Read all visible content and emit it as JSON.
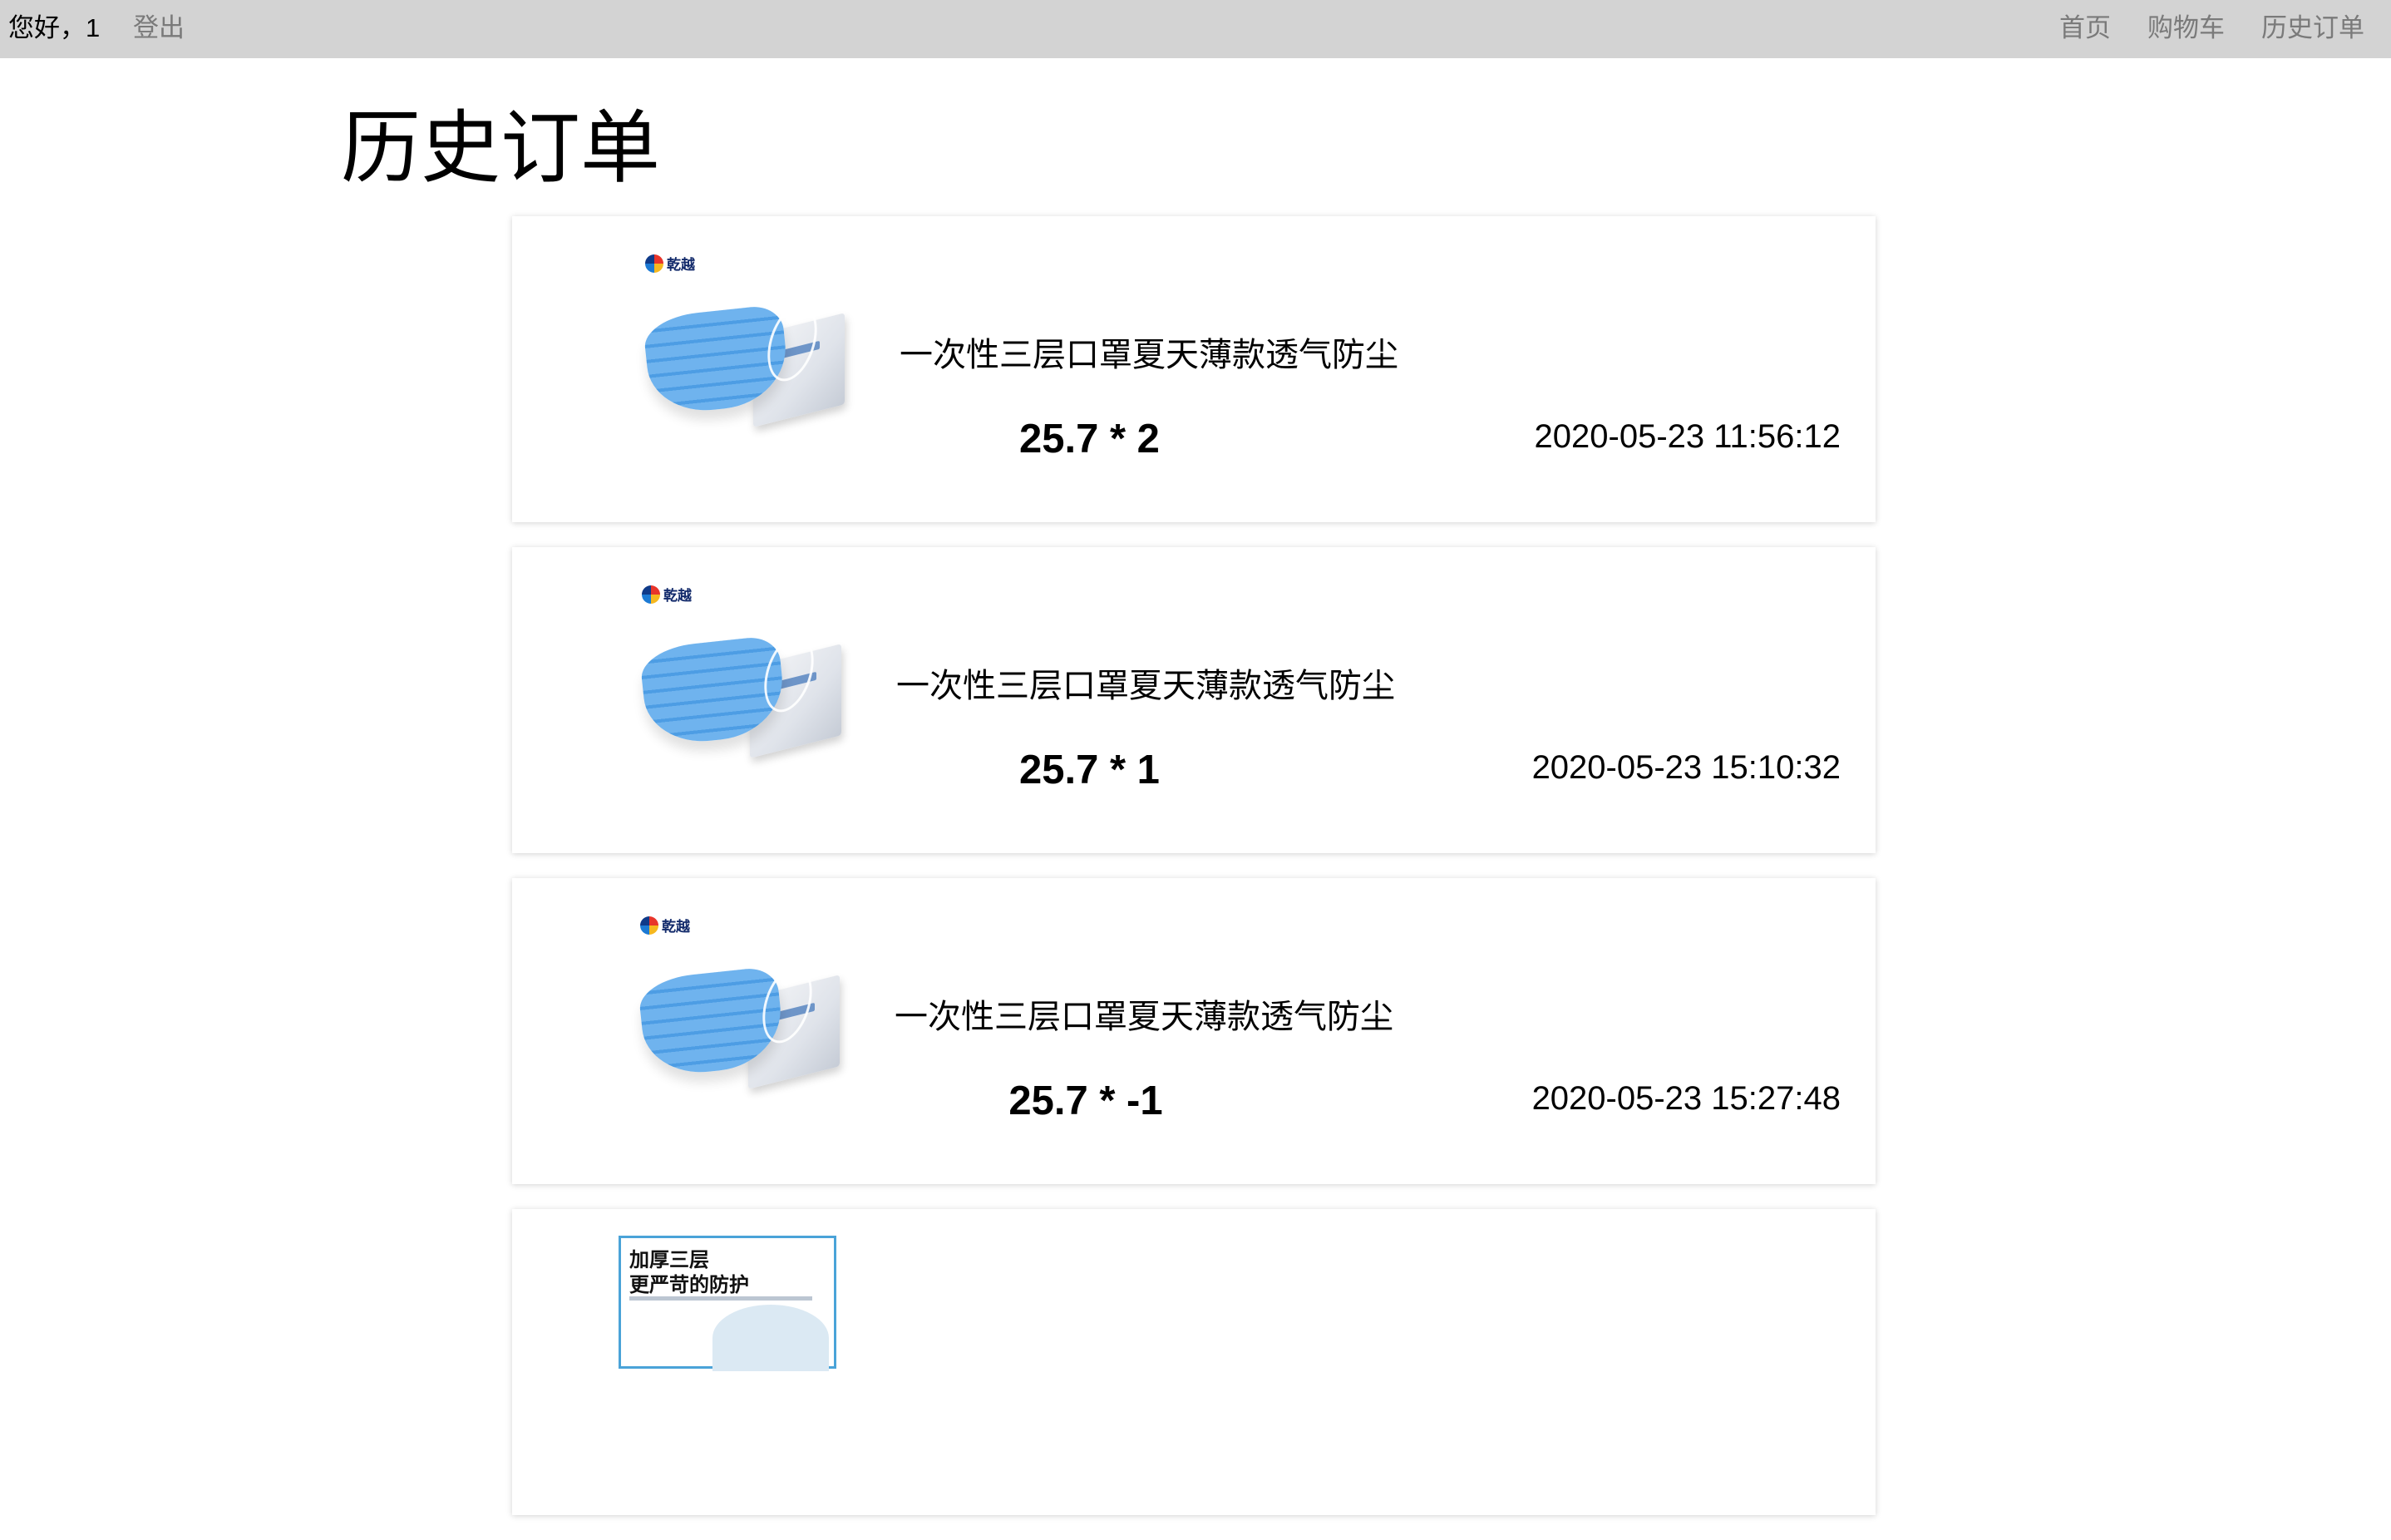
{
  "header": {
    "greeting": "您好，1",
    "logout_label": "登出",
    "nav": [
      {
        "label": "首页"
      },
      {
        "label": "购物车"
      },
      {
        "label": "历史订单"
      }
    ]
  },
  "page": {
    "title": "历史订单"
  },
  "orders": [
    {
      "brand": "乾越",
      "name": "一次性三层口罩夏天薄款透气防尘",
      "price_qty": "25.7 * 2",
      "datetime": "2020-05-23 11:56:12"
    },
    {
      "brand": "乾越",
      "name": "一次性三层口罩夏天薄款透气防尘",
      "price_qty": "25.7 * 1",
      "datetime": "2020-05-23 15:10:32"
    },
    {
      "brand": "乾越",
      "name": "一次性三层口罩夏天薄款透气防尘",
      "price_qty": "25.7 * -1",
      "datetime": "2020-05-23 15:27:48"
    },
    {
      "image_text_line1": "加厚三层",
      "image_text_line2": "更严苛的防护"
    }
  ],
  "colors": {
    "topbar_bg": "#d3d3d3",
    "muted_text": "#7a7a7a",
    "mask_blue": "#6fb3ee"
  }
}
